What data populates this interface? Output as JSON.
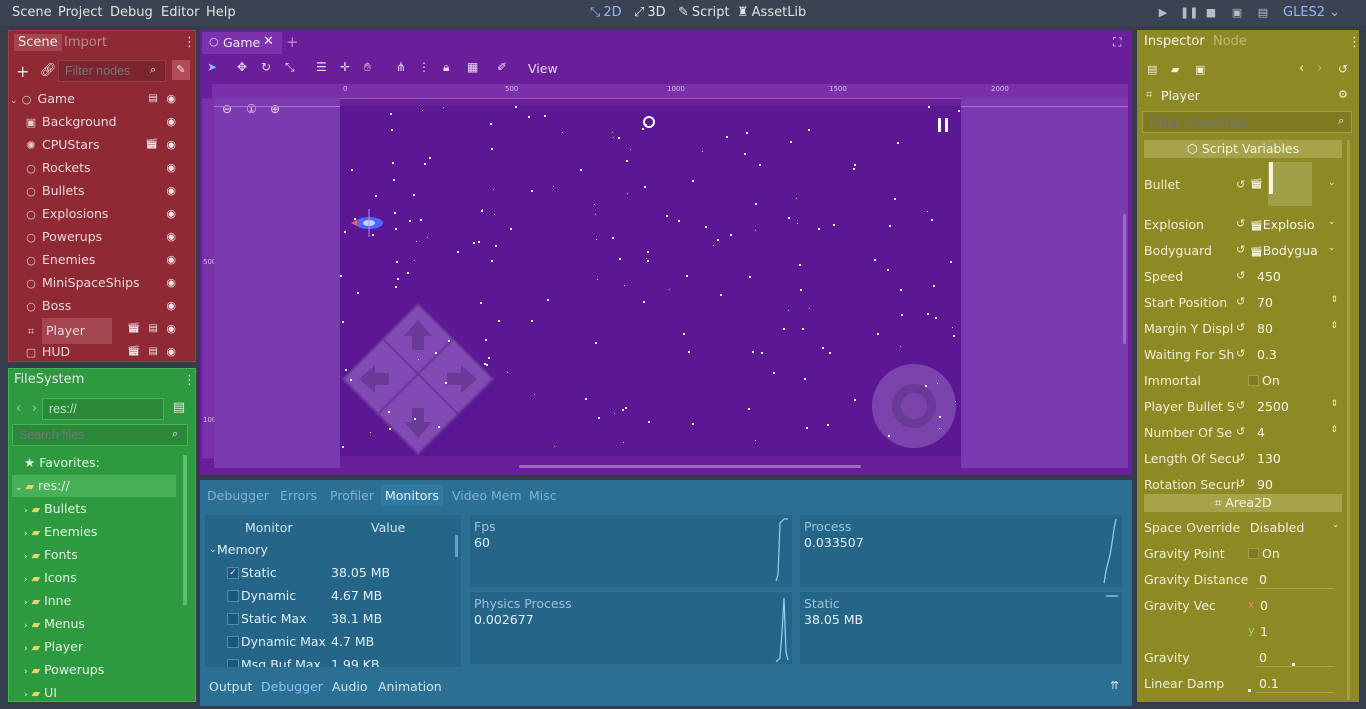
{
  "menu": [
    "Scene",
    "Project",
    "Debug",
    "Editor",
    "Help"
  ],
  "workspaces": [
    {
      "label": "2D",
      "icon": "2d-icon",
      "active": true
    },
    {
      "label": "3D",
      "icon": "3d-icon",
      "active": false
    },
    {
      "label": "Script",
      "icon": "script-icon",
      "active": false
    },
    {
      "label": "AssetLib",
      "icon": "assetlib-icon",
      "active": false
    }
  ],
  "renderer": "GLES2",
  "scene_dock": {
    "tabs": [
      "Scene",
      "Import"
    ],
    "filter_placeholder": "Filter nodes",
    "nodes": [
      {
        "label": "Game",
        "icon": "node2d-icon",
        "level": 0
      },
      {
        "label": "Background",
        "icon": "sprite-icon",
        "level": 1
      },
      {
        "label": "CPUStars",
        "icon": "particles-icon",
        "level": 1
      },
      {
        "label": "Rockets",
        "icon": "node2d-icon",
        "level": 1
      },
      {
        "label": "Bullets",
        "icon": "node2d-icon",
        "level": 1
      },
      {
        "label": "Explosions",
        "icon": "node2d-icon",
        "level": 1
      },
      {
        "label": "Powerups",
        "icon": "node2d-icon",
        "level": 1
      },
      {
        "label": "Enemies",
        "icon": "node2d-icon",
        "level": 1
      },
      {
        "label": "MiniSpaceShips",
        "icon": "node2d-icon",
        "level": 1
      },
      {
        "label": "Boss",
        "icon": "node2d-icon",
        "level": 1
      },
      {
        "label": "Player",
        "icon": "area2d-icon",
        "level": 1,
        "selected": true
      },
      {
        "label": "HUD",
        "icon": "canvaslayer-icon",
        "level": 1
      }
    ]
  },
  "filesystem": {
    "title": "FileSystem",
    "path": "res://",
    "search_placeholder": "Search files",
    "favorites_label": "Favorites:",
    "root": "res://",
    "folders": [
      "Bullets",
      "Enemies",
      "Fonts",
      "Icons",
      "Inne",
      "Menus",
      "Player",
      "Powerups",
      "UI"
    ]
  },
  "viewport": {
    "tab": "Game",
    "view_menu": "View",
    "ruler_marks": [
      "0",
      "500",
      "1000",
      "1500",
      "2000"
    ],
    "ruler_v_marks": [
      "500",
      "1000"
    ]
  },
  "debugger": {
    "tabs": [
      "Debugger",
      "Errors",
      "Profiler",
      "Monitors",
      "Video Mem",
      "Misc"
    ],
    "active_tab": "Monitors",
    "columns": [
      "Monitor",
      "Value"
    ],
    "group": "Memory",
    "rows": [
      {
        "name": "Static",
        "value": "38.05 MB",
        "checked": true
      },
      {
        "name": "Dynamic",
        "value": "4.67 MB",
        "checked": false
      },
      {
        "name": "Static Max",
        "value": "38.1 MB",
        "checked": false
      },
      {
        "name": "Dynamic Max",
        "value": "4.7 MB",
        "checked": false
      },
      {
        "name": "Msg Buf Max",
        "value": "1.99 KB",
        "checked": false
      }
    ],
    "graphs": [
      {
        "title": "Fps",
        "value": "60"
      },
      {
        "title": "Process",
        "value": "0.033507"
      },
      {
        "title": "Physics Process",
        "value": "0.002677"
      },
      {
        "title": "Static",
        "value": "38.05 MB"
      }
    ],
    "bottom_tabs": [
      "Output",
      "Debugger",
      "Audio",
      "Animation"
    ],
    "bottom_active": "Debugger"
  },
  "inspector": {
    "tabs": [
      "Inspector",
      "Node"
    ],
    "object": "Player",
    "filter_placeholder": "Filter properties",
    "script_section": "Script Variables",
    "properties": [
      {
        "label": "Bullet",
        "value": "",
        "type": "resource"
      },
      {
        "label": "Explosion",
        "value": "Explosio",
        "type": "resource"
      },
      {
        "label": "Bodyguard",
        "value": "Bodygua",
        "type": "resource"
      },
      {
        "label": "Speed",
        "value": "450",
        "type": "text"
      },
      {
        "label": "Start Position",
        "value": "70",
        "type": "spin"
      },
      {
        "label": "Margin Y Displ",
        "value": "80",
        "type": "spin"
      },
      {
        "label": "Waiting For Sh",
        "value": "0.3",
        "type": "text"
      },
      {
        "label": "Immortal",
        "value": "On",
        "type": "check"
      },
      {
        "label": "Player Bullet S",
        "value": "2500",
        "type": "spin"
      },
      {
        "label": "Number Of Se",
        "value": "4",
        "type": "spin"
      },
      {
        "label": "Length Of Secu",
        "value": "130",
        "type": "text"
      },
      {
        "label": "Rotation Securi",
        "value": "90",
        "type": "text"
      }
    ],
    "area_section": "Area2D",
    "area_properties": [
      {
        "label": "Space Override",
        "value": "Disabled",
        "type": "select"
      },
      {
        "label": "Gravity Point",
        "value": "On",
        "type": "check"
      },
      {
        "label": "Gravity Distance",
        "value": "0",
        "type": "slider"
      },
      {
        "label": "Gravity Vec",
        "x": "0",
        "y": "1",
        "type": "vector"
      },
      {
        "label": "Gravity",
        "value": "0",
        "type": "slider"
      },
      {
        "label": "Linear Damp",
        "value": "0.1",
        "type": "slider"
      }
    ]
  },
  "colors": {
    "scene_dock": "#8f2a35",
    "filesystem_dock": "#2e9a3f",
    "viewport": "#6b1e9a",
    "debugger": "#2b6f93",
    "inspector": "#8d8a26",
    "accent": "#8fb6ff"
  }
}
